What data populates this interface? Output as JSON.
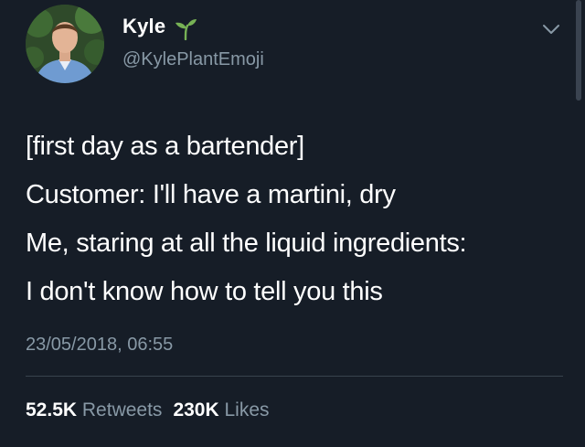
{
  "author": {
    "display_name": "Kyle",
    "handle": "@KylePlantEmoji",
    "avatar_icon": "profile-photo",
    "name_emoji_icon": "seedling-icon"
  },
  "tweet": {
    "lines": [
      "[first day as a bartender]",
      "Customer: I'll have a martini, dry",
      "Me, staring at all the liquid ingredients:",
      "I don't know how to tell you this"
    ],
    "timestamp": "23/05/2018, 06:55"
  },
  "stats": {
    "retweets_count": "52.5K",
    "retweets_label": "Retweets",
    "likes_count": "230K",
    "likes_label": "Likes"
  },
  "colors": {
    "background": "#161d27",
    "text_primary": "#ffffff",
    "text_secondary": "#8899a6",
    "divider": "#38444d",
    "sprout_green": "#77b255"
  }
}
